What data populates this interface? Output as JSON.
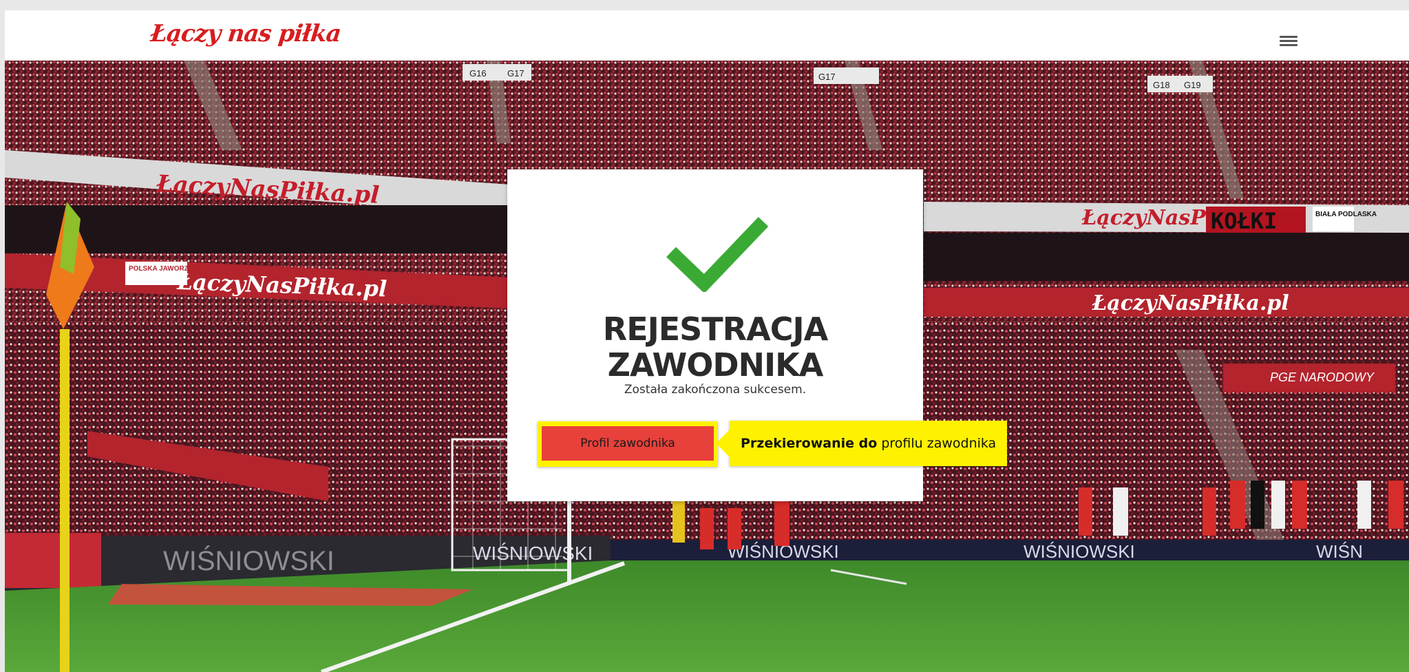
{
  "header": {
    "logo_text": "Łączy nas piłka",
    "menu_icon": "hamburger-menu-icon"
  },
  "hero": {
    "banners": [
      "ŁączyNasPiłka.pl",
      "ŁączyNasPiłka.pl",
      "ŁączyNasPiłka.pl",
      "ŁączyNasPiłka",
      "KOŁKI",
      "BIAŁA PODLASKA"
    ],
    "sector_signs": [
      "G16",
      "G17",
      "G17",
      "G18",
      "G18",
      "G19"
    ],
    "adboards": [
      "WIŚNIOWSKI",
      "WIŚNIOWSKI",
      "WIŚNIOWSKI",
      "WIŚNIOWSKI",
      "WIŚN"
    ],
    "club_sign": "POLSKA JAWORZNO",
    "stadium_sign": "PGE NARODOWY"
  },
  "card": {
    "icon": "checkmark-icon",
    "title_line1": "REJESTRACJA",
    "title_line2": "ZAWODNIKA",
    "subtitle": "Została zakończona sukcesem.",
    "button_label": "Profil zawodnika"
  },
  "callout": {
    "bold_text": "Przekierowanie do",
    "rest_text": " profilu zawodnika"
  },
  "colors": {
    "brand_red": "#d71d20",
    "button_red": "#e8403a",
    "check_green": "#3aaa35",
    "highlight_yellow": "#fff200"
  }
}
